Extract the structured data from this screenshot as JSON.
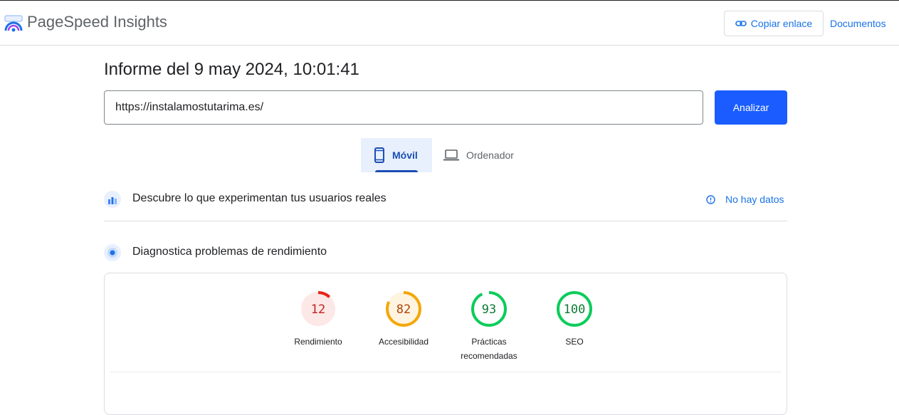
{
  "header": {
    "app_title": "PageSpeed Insights",
    "copy_link_label": "Copiar enlace",
    "docs_label": "Documentos"
  },
  "report": {
    "title": "Informe del 9 may 2024, 10:01:41",
    "url_value": "https://instalamostutarima.es/",
    "analyze_label": "Analizar"
  },
  "device_tabs": [
    {
      "label": "Móvil",
      "icon": "smartphone-icon",
      "selected": true
    },
    {
      "label": "Ordenador",
      "icon": "laptop-icon",
      "selected": false
    }
  ],
  "field_section": {
    "title": "Descubre lo que experimentan tus usuarios reales",
    "status": "No hay datos"
  },
  "lab_section": {
    "title": "Diagnostica problemas de rendimiento"
  },
  "scores": [
    {
      "label": "Rendimiento",
      "value": "12",
      "fraction": 0.12,
      "color": "#e8251a",
      "bg": "#fce8e6",
      "text": "#c5221f"
    },
    {
      "label": "Accesibilidad",
      "value": "82",
      "fraction": 0.82,
      "color": "#f4a70a",
      "bg": "#fff4e0",
      "text": "#b1420a"
    },
    {
      "label": "Prácticas recomendadas",
      "value": "93",
      "fraction": 0.93,
      "color": "#0ccc5c",
      "bg": "#ffffff",
      "text": "#0d7b34"
    },
    {
      "label": "SEO",
      "value": "100",
      "fraction": 1.0,
      "color": "#0ccc5c",
      "bg": "#ffffff",
      "text": "#0d7b34"
    }
  ],
  "colors": {
    "accent": "#1a73e8",
    "primary_button": "#1a5cff"
  }
}
